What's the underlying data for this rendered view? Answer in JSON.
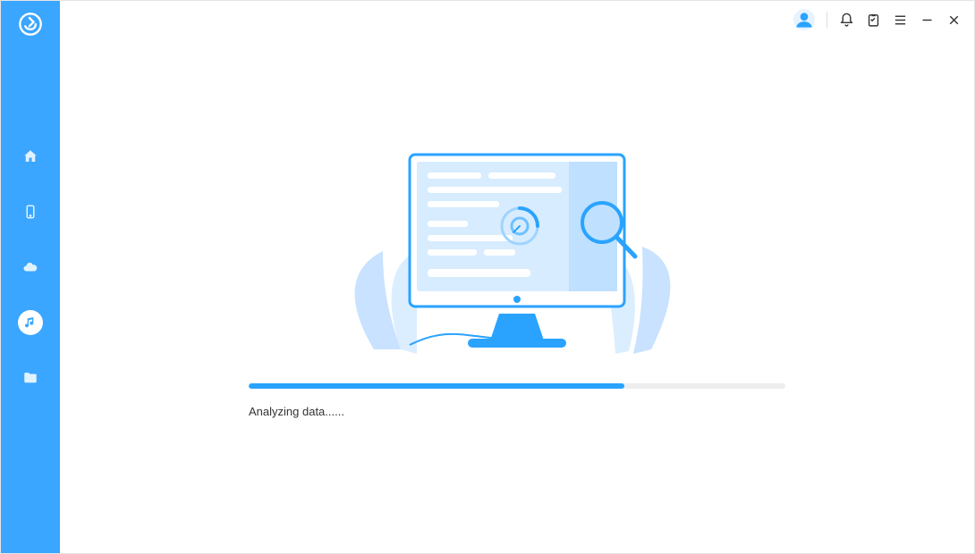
{
  "sidebar": {
    "items": [
      {
        "name": "home",
        "active": false
      },
      {
        "name": "device",
        "active": false
      },
      {
        "name": "cloud",
        "active": false
      },
      {
        "name": "music",
        "active": true
      },
      {
        "name": "folder",
        "active": false
      }
    ]
  },
  "header": {
    "buttons": [
      "account",
      "notifications",
      "clipboard",
      "menu",
      "minimize",
      "close"
    ]
  },
  "progress": {
    "percent": 70,
    "status_text": "Analyzing data......"
  },
  "colors": {
    "accent": "#2aa3ff",
    "sidebar_bg": "#3ba6ff",
    "progress_track": "#eeeeee"
  }
}
